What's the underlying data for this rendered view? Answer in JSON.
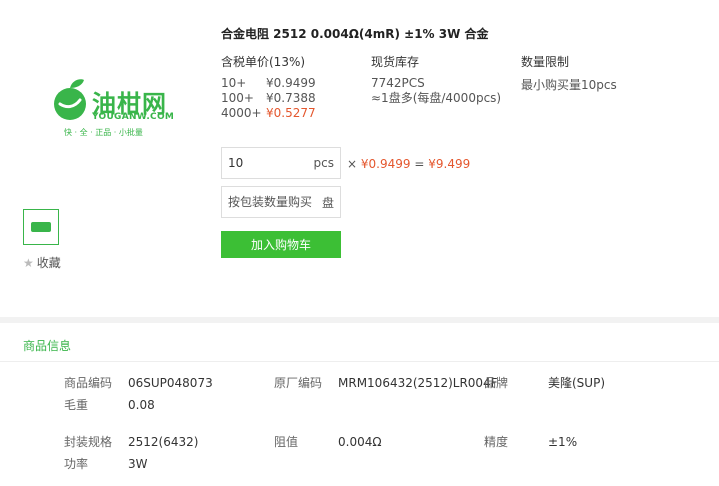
{
  "product": {
    "title": "合金电阻 2512 0.004Ω(4mR) ±1% 3W 合金"
  },
  "logo": {
    "brand": "油柑网",
    "domain": "YOUGANW.COM",
    "slogan": "快 · 全 · 正品 · 小批量",
    "color": "#39b54a"
  },
  "favorite": {
    "label": "收藏",
    "icon": "star-icon"
  },
  "pricing": {
    "header": "含税单价(13%)",
    "tiers": [
      {
        "qty": "10+",
        "price": "¥0.9499",
        "highlight": false
      },
      {
        "qty": "100+",
        "price": "¥0.7388",
        "highlight": false
      },
      {
        "qty": "4000+",
        "price": "¥0.5277",
        "highlight": true
      }
    ]
  },
  "stock": {
    "header": "现货库存",
    "count": "7742PCS",
    "reel": "≈1盘多(每盘/4000pcs)"
  },
  "limit": {
    "header": "数量限制",
    "min": "最小购买量10pcs"
  },
  "order": {
    "qty_value": "10",
    "qty_unit": "pcs",
    "times": "×",
    "unit_price": "¥0.9499",
    "equals": "=",
    "total": "¥9.499",
    "pkg_placeholder": "按包装数量购买",
    "pkg_unit": "盘",
    "add_to_cart": "加入购物车"
  },
  "info": {
    "title": "商品信息",
    "attrs": [
      {
        "label": "商品编码",
        "value": "06SUP048073"
      },
      {
        "label": "原厂编码",
        "value": "MRM106432(2512)LR004F"
      },
      {
        "label": "品牌",
        "value": "美隆(SUP)"
      },
      {
        "label": "毛重",
        "value": "0.08"
      },
      {
        "label": "封装规格",
        "value": "2512(6432)"
      },
      {
        "label": "阻值",
        "value": "0.004Ω"
      },
      {
        "label": "精度",
        "value": "±1%"
      },
      {
        "label": "功率",
        "value": "3W"
      }
    ]
  },
  "colors": {
    "accent": "#39b54a",
    "button": "#3cbf35",
    "price_highlight": "#e4572e"
  }
}
